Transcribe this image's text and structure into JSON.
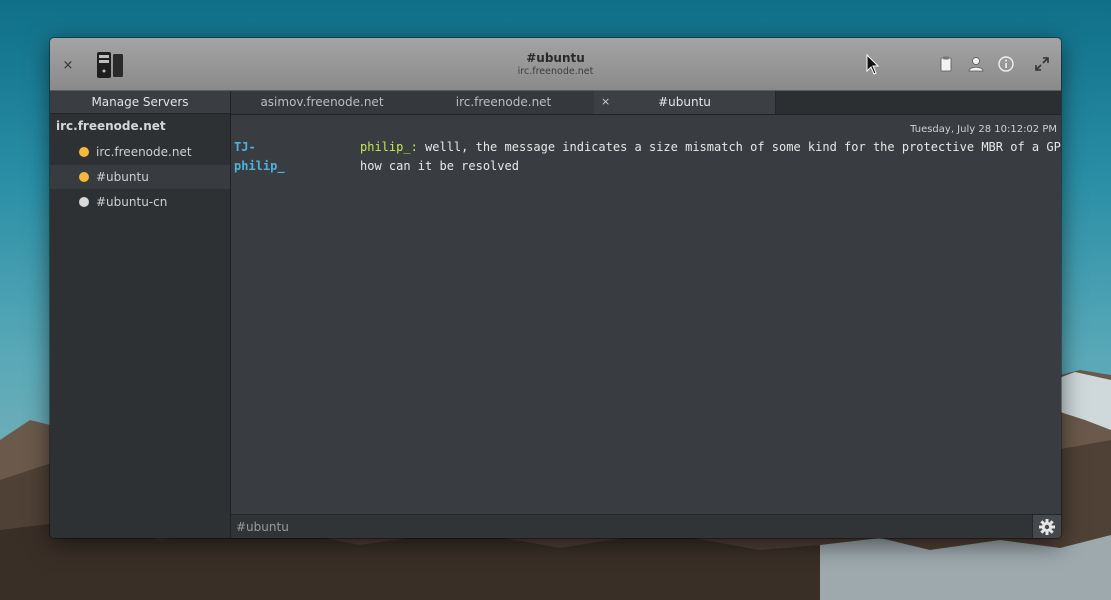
{
  "window": {
    "title": "#ubuntu",
    "subtitle": "irc.freenode.net",
    "close_glyph": "×",
    "app_icon": "server-icon",
    "toolbar_icons": [
      "clipboard-icon",
      "user-icon",
      "info-icon",
      "fullscreen-icon"
    ]
  },
  "sidebar": {
    "manage_label": "Manage Servers",
    "server_name": "irc.freenode.net",
    "channels": [
      {
        "label": "irc.freenode.net",
        "status_color": "#f5b83d"
      },
      {
        "label": "#ubuntu",
        "status_color": "#f5b83d",
        "selected": true
      },
      {
        "label": "#ubuntu-cn",
        "status_color": "#d8d8d8"
      }
    ]
  },
  "tabs": [
    {
      "label": "asimov.freenode.net"
    },
    {
      "label": "irc.freenode.net"
    },
    {
      "label": "#ubuntu",
      "active": true,
      "close_glyph": "×"
    }
  ],
  "chat": {
    "timestamp": "Tuesday, July 28 10:12:02 PM",
    "messages": [
      {
        "nick": "TJ-",
        "mention": "philip_:",
        "text": "  welll, the message indicates a size mismatch of some kind for the protective MBR of a GPT"
      },
      {
        "nick": "philip_",
        "mention": "",
        "text": "how can it be resolved"
      }
    ]
  },
  "input": {
    "placeholder": "#ubuntu",
    "settings_icon": "gear-icon"
  },
  "colors": {
    "nick": "#4fb3d9",
    "mention": "#c6e94f",
    "chat_bg": "#393c40",
    "sidebar_bg": "#2e3134"
  }
}
